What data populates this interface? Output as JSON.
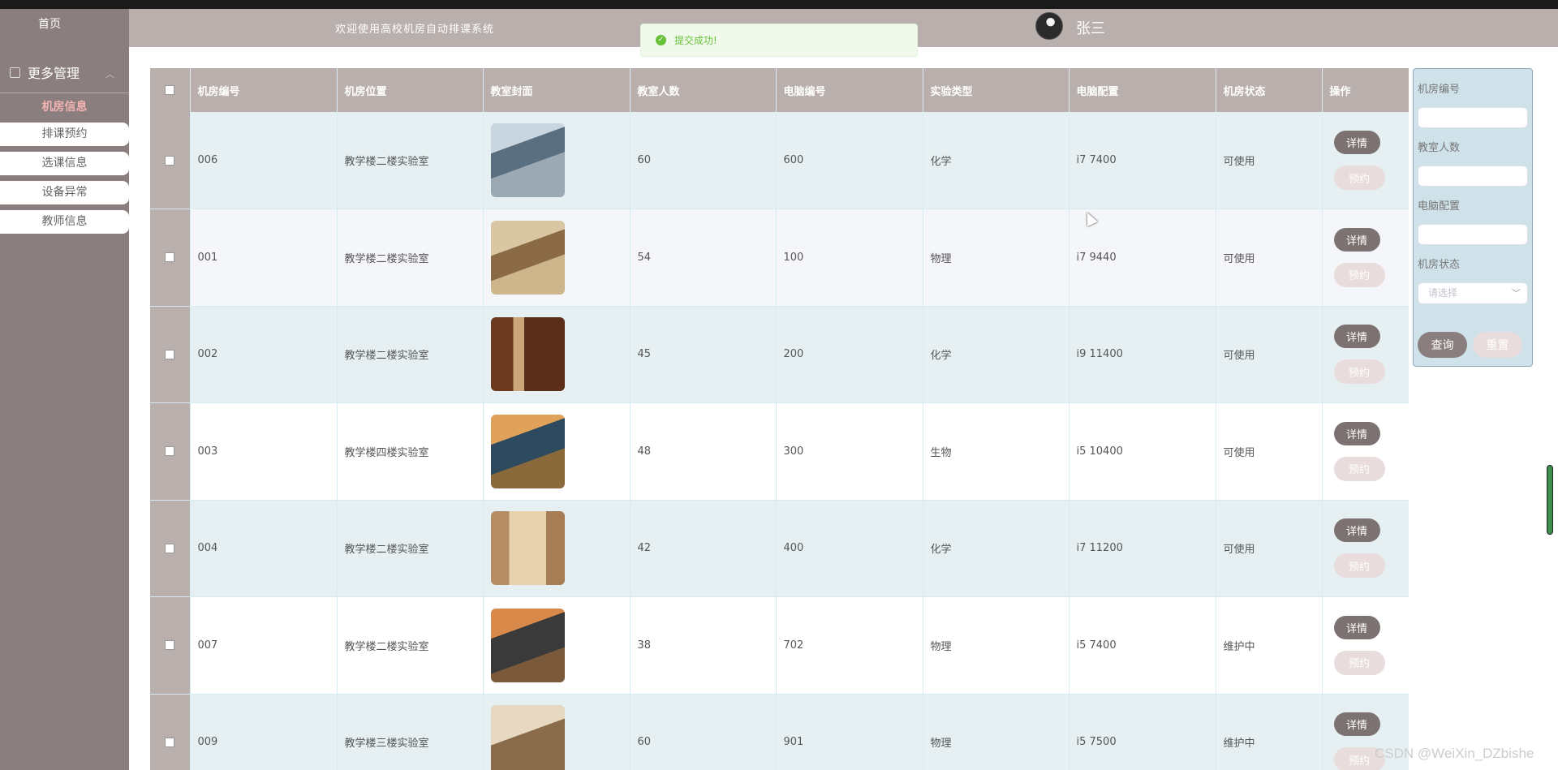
{
  "sidebar": {
    "home": "首页",
    "group_label": "更多管理",
    "active_item": "机房信息",
    "items": [
      "排课预约",
      "选课信息",
      "设备异常",
      "教师信息"
    ]
  },
  "header": {
    "welcome": "欢迎使用高校机房自动排课系统",
    "username": "张三"
  },
  "toast": {
    "message": "提交成功!"
  },
  "table": {
    "columns": [
      "机房编号",
      "机房位置",
      "教室封面",
      "教室人数",
      "电脑编号",
      "实验类型",
      "电脑配置",
      "机房状态",
      "操作"
    ],
    "detail_label": "详情",
    "reserve_label": "预约",
    "rows": [
      {
        "id": "006",
        "location": "教学楼二楼实验室",
        "capacity": "60",
        "pc_no": "600",
        "exp_type": "化学",
        "config": "i7 7400",
        "status": "可使用"
      },
      {
        "id": "001",
        "location": "教学楼二楼实验室",
        "capacity": "54",
        "pc_no": "100",
        "exp_type": "物理",
        "config": "i7 9440",
        "status": "可使用"
      },
      {
        "id": "002",
        "location": "教学楼二楼实验室",
        "capacity": "45",
        "pc_no": "200",
        "exp_type": "化学",
        "config": "i9 11400",
        "status": "可使用"
      },
      {
        "id": "003",
        "location": "教学楼四楼实验室",
        "capacity": "48",
        "pc_no": "300",
        "exp_type": "生物",
        "config": "i5 10400",
        "status": "可使用"
      },
      {
        "id": "004",
        "location": "教学楼二楼实验室",
        "capacity": "42",
        "pc_no": "400",
        "exp_type": "化学",
        "config": "i7 11200",
        "status": "可使用"
      },
      {
        "id": "007",
        "location": "教学楼二楼实验室",
        "capacity": "38",
        "pc_no": "702",
        "exp_type": "物理",
        "config": "i5 7400",
        "status": "维护中"
      },
      {
        "id": "009",
        "location": "教学楼三楼实验室",
        "capacity": "60",
        "pc_no": "901",
        "exp_type": "物理",
        "config": "i5 7500",
        "status": "维护中"
      }
    ]
  },
  "search": {
    "room_no_label": "机房编号",
    "capacity_label": "教室人数",
    "config_label": "电脑配置",
    "status_label": "机房状态",
    "status_placeholder": "请选择",
    "query_label": "查询",
    "reset_label": "重置"
  },
  "watermark": "CSDN @WeiXin_DZbishe"
}
